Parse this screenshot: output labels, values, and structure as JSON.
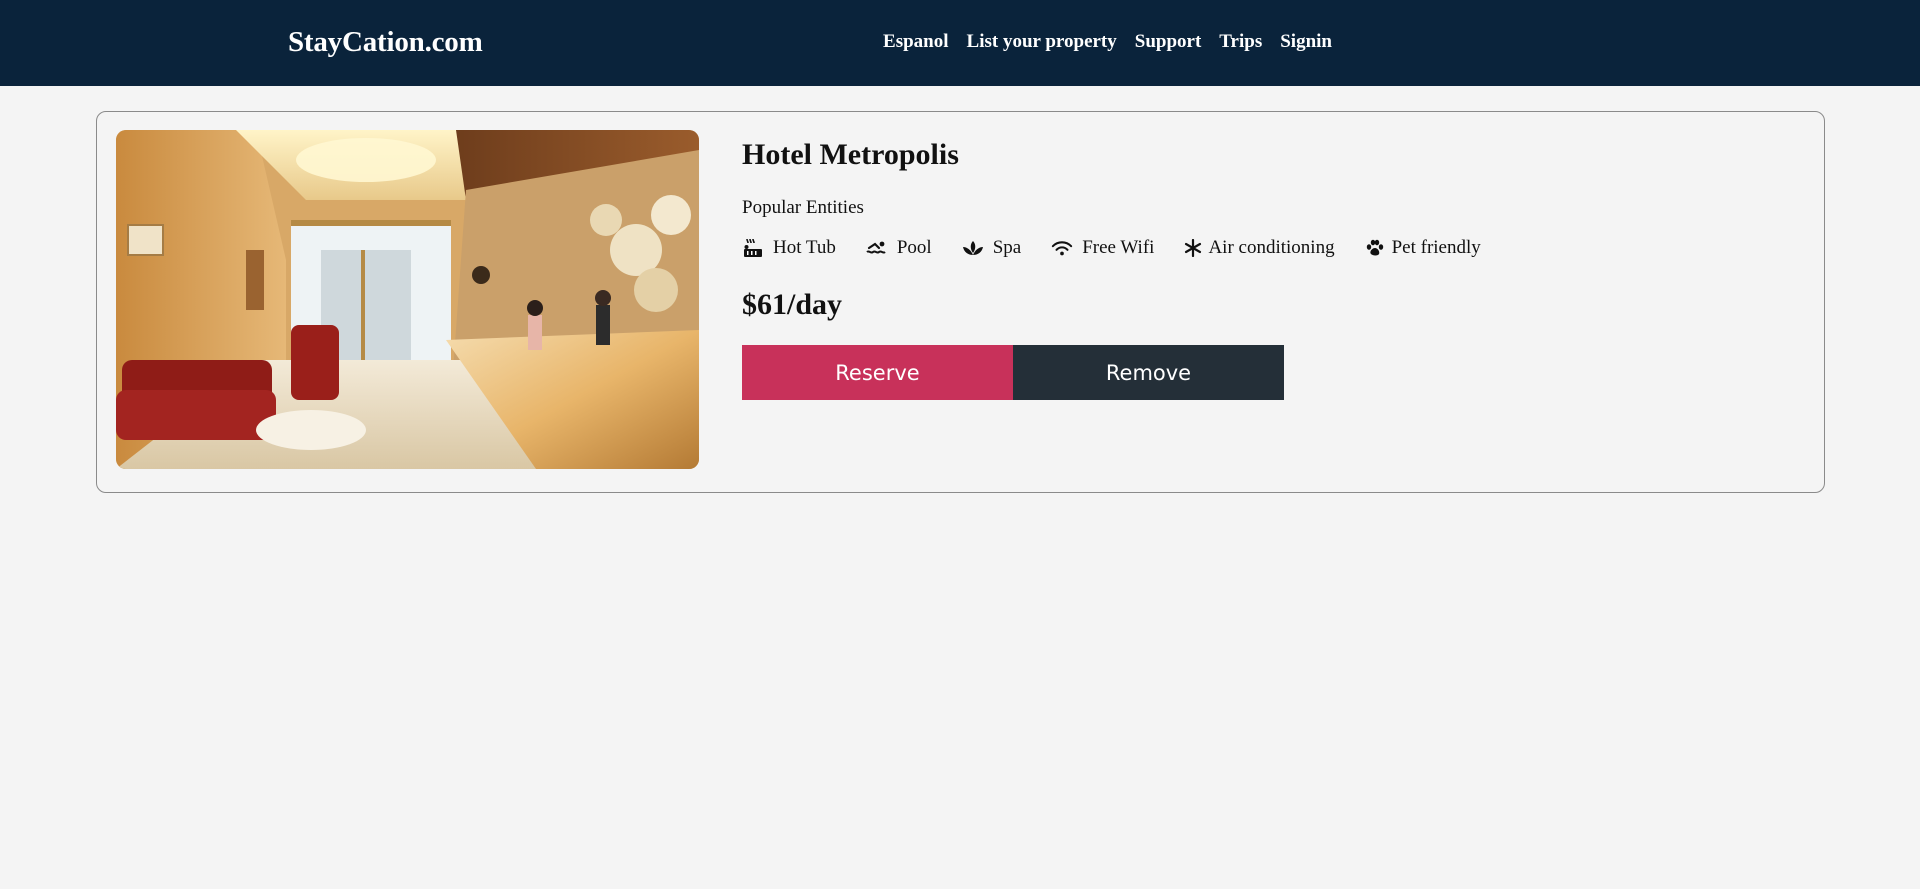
{
  "header": {
    "brand": "StayCation.com",
    "nav": [
      "Espanol",
      "List your property",
      "Support",
      "Trips",
      "Signin"
    ],
    "bg_color": "#0a233b"
  },
  "listing": {
    "name": "Hotel Metropolis",
    "popular_label": "Popular Entities",
    "amenities": [
      {
        "label": "Hot Tub",
        "icon": "hot-tub-icon"
      },
      {
        "label": "Pool",
        "icon": "swimmer-icon"
      },
      {
        "label": "Spa",
        "icon": "spa-lotus-icon"
      },
      {
        "label": "Free Wifi",
        "icon": "wifi-icon"
      },
      {
        "label": "Air conditioning",
        "icon": "snowflake-icon"
      },
      {
        "label": "Pet friendly",
        "icon": "paw-icon"
      }
    ],
    "price": "$61/day",
    "reserve_label": "Reserve",
    "remove_label": "Remove"
  },
  "colors": {
    "reserve": "#c8315a",
    "remove": "#242f38",
    "page_bg": "#f4f4f4"
  }
}
